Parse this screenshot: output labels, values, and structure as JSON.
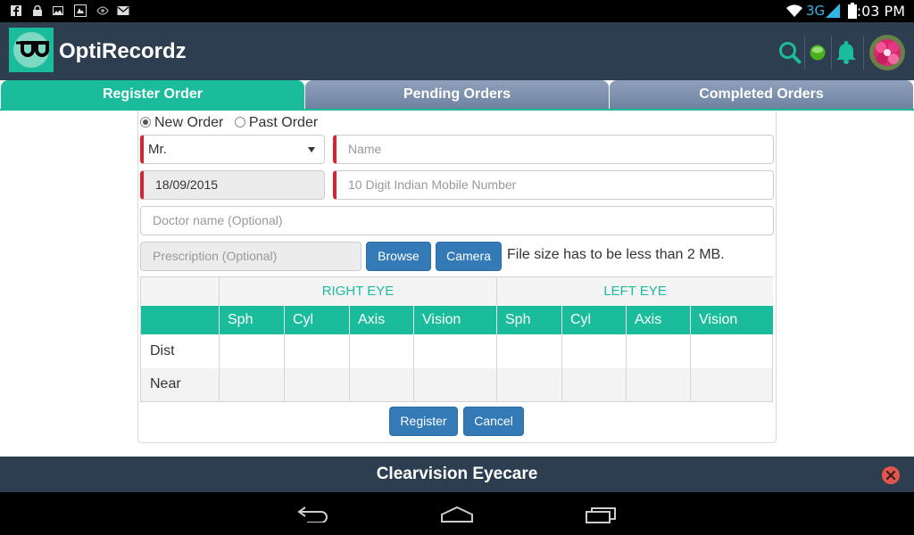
{
  "status_bar": {
    "time": "1:03 PM",
    "network": "3G",
    "icons": [
      "facebook-icon",
      "lock-icon",
      "image-icon",
      "app-icon",
      "eye-icon",
      "mail-icon"
    ]
  },
  "app": {
    "title": "OptiRecordz",
    "brand_color": "#1abc9c",
    "header_color": "#2c3e50"
  },
  "tabs": [
    {
      "label": "Register Order",
      "active": true
    },
    {
      "label": "Pending Orders",
      "active": false
    },
    {
      "label": "Completed Orders",
      "active": false
    }
  ],
  "form": {
    "order_type": {
      "options": [
        "New Order",
        "Past Order"
      ],
      "selected": "New Order"
    },
    "salutation": {
      "value": "Mr."
    },
    "name": {
      "placeholder": "Name",
      "value": ""
    },
    "date": {
      "value": "18/09/2015"
    },
    "mobile": {
      "placeholder": "10 Digit Indian Mobile Number",
      "value": ""
    },
    "doctor": {
      "placeholder": "Doctor name (Optional)",
      "value": ""
    },
    "prescription": {
      "placeholder": "Prescription (Optional)",
      "value": ""
    },
    "browse_label": "Browse",
    "camera_label": "Camera",
    "file_note": "File size has to be less than 2 MB.",
    "register_label": "Register",
    "cancel_label": "Cancel"
  },
  "rx_table": {
    "groups": [
      "RIGHT EYE",
      "LEFT EYE"
    ],
    "columns": [
      "Sph",
      "Cyl",
      "Axis",
      "Vision",
      "Sph",
      "Cyl",
      "Axis",
      "Vision"
    ],
    "rows": [
      {
        "label": "Dist",
        "values": [
          "",
          "",
          "",
          "",
          "",
          "",
          "",
          ""
        ]
      },
      {
        "label": "Near",
        "values": [
          "",
          "",
          "",
          "",
          "",
          "",
          "",
          ""
        ]
      }
    ]
  },
  "footer": {
    "store_name": "Clearvision Eyecare"
  }
}
